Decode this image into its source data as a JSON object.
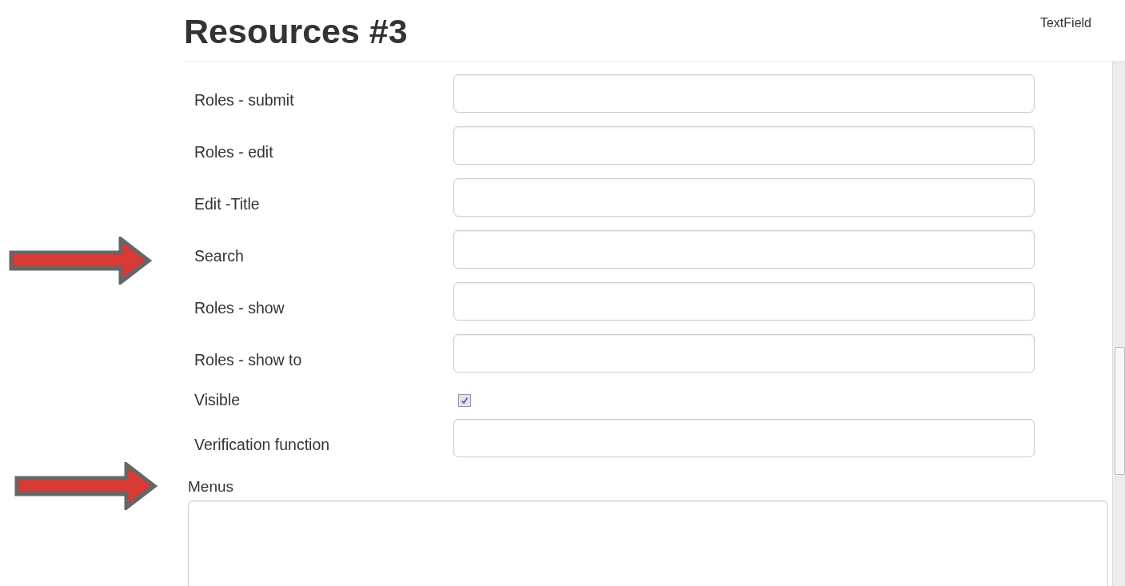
{
  "header": {
    "title": "Resources #3",
    "type_label": "TextField"
  },
  "form": {
    "rows": [
      {
        "label": "Roles - submit",
        "kind": "text"
      },
      {
        "label": "Roles - edit",
        "kind": "text"
      },
      {
        "label": "Edit -Title",
        "kind": "text"
      },
      {
        "label": "Search",
        "kind": "text"
      },
      {
        "label": "Roles - show",
        "kind": "text"
      },
      {
        "label": "Roles - show to",
        "kind": "text"
      },
      {
        "label": "Visible",
        "kind": "checkbox",
        "checked": true
      },
      {
        "label": "Verification function",
        "kind": "text"
      }
    ],
    "menus": {
      "label": "Menus"
    }
  }
}
